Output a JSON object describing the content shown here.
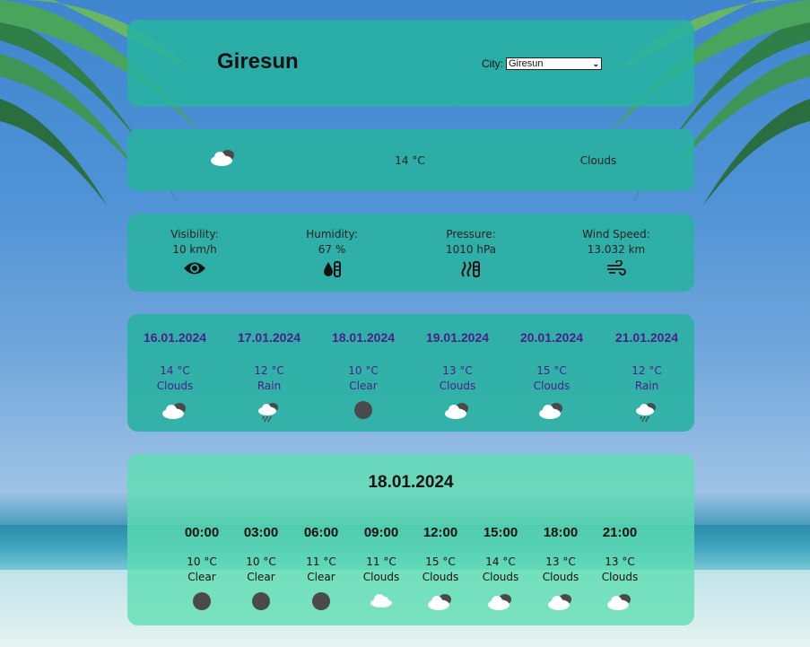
{
  "header": {
    "city": "Giresun",
    "city_label": "City:",
    "selected_city": "Giresun"
  },
  "current": {
    "temp": "14 °C",
    "description": "Clouds",
    "icon": "cloud-icon"
  },
  "details": [
    {
      "label": "Visibility:",
      "value": "10 km/h",
      "icon": "eye-icon"
    },
    {
      "label": "Humidity:",
      "value": "67 %",
      "icon": "humidity-icon"
    },
    {
      "label": "Pressure:",
      "value": "1010 hPa",
      "icon": "pressure-icon"
    },
    {
      "label": "Wind Speed:",
      "value": "13.032 km",
      "icon": "wind-icon"
    }
  ],
  "week": [
    {
      "date": "16.01.2024",
      "temp": "14 °C",
      "desc": "Clouds",
      "icon": "cloud-icon"
    },
    {
      "date": "17.01.2024",
      "temp": "12 °C",
      "desc": "Rain",
      "icon": "rain-icon"
    },
    {
      "date": "18.01.2024",
      "temp": "10 °C",
      "desc": "Clear",
      "icon": "moon-icon"
    },
    {
      "date": "19.01.2024",
      "temp": "13 °C",
      "desc": "Clouds",
      "icon": "cloud-icon"
    },
    {
      "date": "20.01.2024",
      "temp": "15 °C",
      "desc": "Clouds",
      "icon": "cloud-icon"
    },
    {
      "date": "21.01.2024",
      "temp": "12 °C",
      "desc": "Rain",
      "icon": "rain-icon"
    }
  ],
  "day": {
    "date": "18.01.2024",
    "hours": [
      {
        "time": "00:00",
        "temp": "10 °C",
        "desc": "Clear",
        "icon": "moon-icon"
      },
      {
        "time": "03:00",
        "temp": "10 °C",
        "desc": "Clear",
        "icon": "moon-icon"
      },
      {
        "time": "06:00",
        "temp": "11 °C",
        "desc": "Clear",
        "icon": "moon-icon"
      },
      {
        "time": "09:00",
        "temp": "11 °C",
        "desc": "Clouds",
        "icon": "light-cloud-icon"
      },
      {
        "time": "12:00",
        "temp": "15 °C",
        "desc": "Clouds",
        "icon": "cloud-icon"
      },
      {
        "time": "15:00",
        "temp": "14 °C",
        "desc": "Clouds",
        "icon": "cloud-icon"
      },
      {
        "time": "18:00",
        "temp": "13 °C",
        "desc": "Clouds",
        "icon": "cloud-icon"
      },
      {
        "time": "21:00",
        "temp": "13 °C",
        "desc": "Clouds",
        "icon": "cloud-icon"
      }
    ]
  }
}
